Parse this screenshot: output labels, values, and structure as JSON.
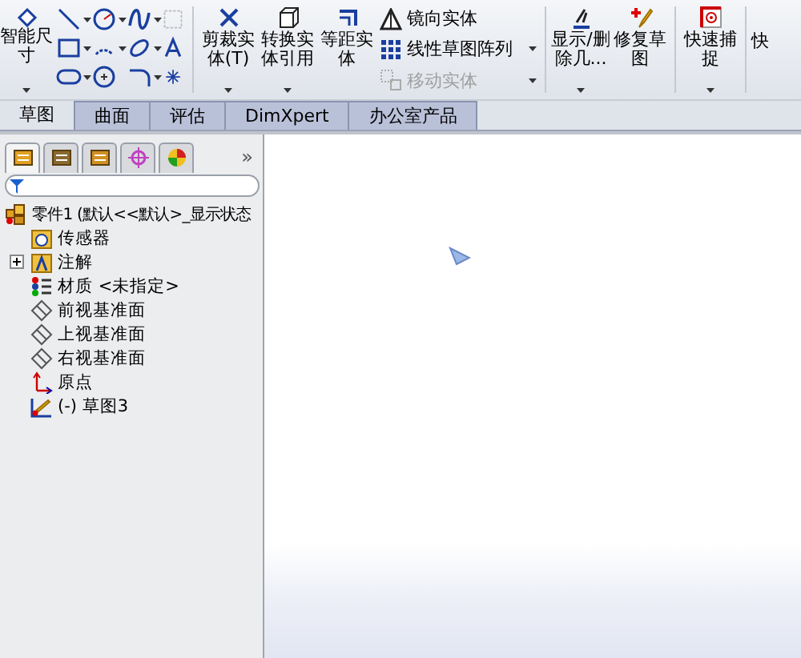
{
  "toolbar": {
    "big_left": {
      "label": "智能尺寸",
      "dropdown": true
    },
    "buttons": [
      {
        "kind": "big",
        "label": "剪裁实体(T)",
        "dropdown": true
      },
      {
        "kind": "big",
        "label": "转换实体引用",
        "dropdown": true
      },
      {
        "kind": "big",
        "label": "等距实体",
        "dropdown": false
      },
      {
        "kind": "stack",
        "items": [
          {
            "label": "镜向实体",
            "disabled": false,
            "dropdown": false
          },
          {
            "label": "线性草图阵列",
            "disabled": false,
            "dropdown": true
          },
          {
            "label": "移动实体",
            "disabled": true,
            "dropdown": true
          }
        ]
      },
      {
        "kind": "divider"
      },
      {
        "kind": "big",
        "label": "显示/删除几...",
        "dropdown": true
      },
      {
        "kind": "big",
        "label": "修复草图",
        "dropdown": false
      },
      {
        "kind": "divider"
      },
      {
        "kind": "big",
        "label": "快速捕捉",
        "dropdown": true
      },
      {
        "kind": "divider"
      },
      {
        "kind": "cut",
        "label": "快"
      }
    ]
  },
  "tabs": [
    {
      "label": "草图",
      "selected": true
    },
    {
      "label": "曲面",
      "selected": false
    },
    {
      "label": "评估",
      "selected": false
    },
    {
      "label": "DimXpert",
      "selected": false
    },
    {
      "label": "办公室产品",
      "selected": false
    }
  ],
  "panel": {
    "tabs": [
      {
        "selected": true
      },
      {
        "selected": false
      },
      {
        "selected": false
      },
      {
        "selected": false
      },
      {
        "selected": false
      }
    ],
    "more": "»",
    "tree": {
      "label": "零件1  (默认<<默认>_显示状态",
      "children": [
        {
          "label": "传感器",
          "expandable": false
        },
        {
          "label": "注解",
          "expandable": true
        },
        {
          "label": "材质 <未指定>",
          "expandable": false
        },
        {
          "label": "前视基准面",
          "expandable": false
        },
        {
          "label": "上视基准面",
          "expandable": false
        },
        {
          "label": "右视基准面",
          "expandable": false
        },
        {
          "label": "原点",
          "expandable": false
        },
        {
          "label": "(-) 草图3",
          "expandable": false
        }
      ]
    }
  }
}
